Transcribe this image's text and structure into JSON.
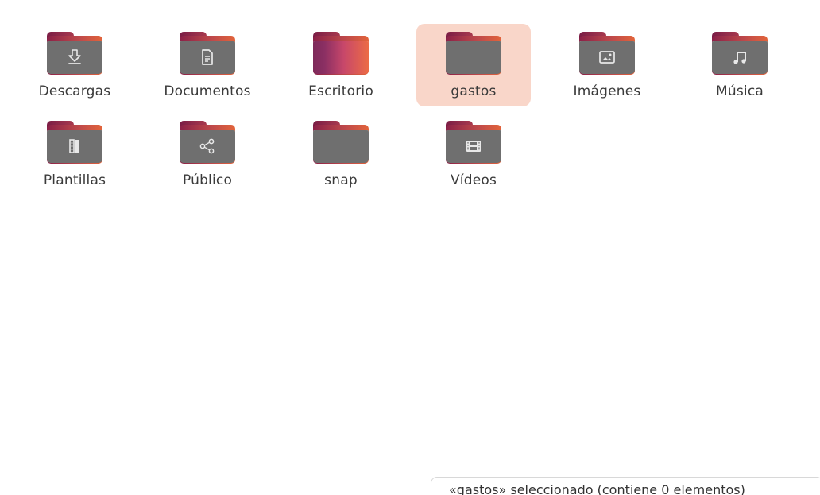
{
  "folders": [
    {
      "name": "Descargas",
      "icon": "download-icon"
    },
    {
      "name": "Documentos",
      "icon": "document-icon"
    },
    {
      "name": "Escritorio",
      "icon": "desktop-folder-icon"
    },
    {
      "name": "gastos",
      "icon": "folder-icon",
      "selected": true
    },
    {
      "name": "Imágenes",
      "icon": "image-icon"
    },
    {
      "name": "Música",
      "icon": "music-icon"
    },
    {
      "name": "Plantillas",
      "icon": "template-icon"
    },
    {
      "name": "Público",
      "icon": "share-icon"
    },
    {
      "name": "snap",
      "icon": "folder-icon"
    },
    {
      "name": "Vídeos",
      "icon": "video-icon"
    }
  ],
  "status_bar": {
    "text": "«gastos» seleccionado  (contiene 0 elementos)"
  },
  "colors": {
    "selection_bg": "#f9d6c9",
    "folder_body": "#6f6f6f",
    "folder_tab_start": "#7a1d45",
    "folder_tab_end": "#e2643b"
  }
}
